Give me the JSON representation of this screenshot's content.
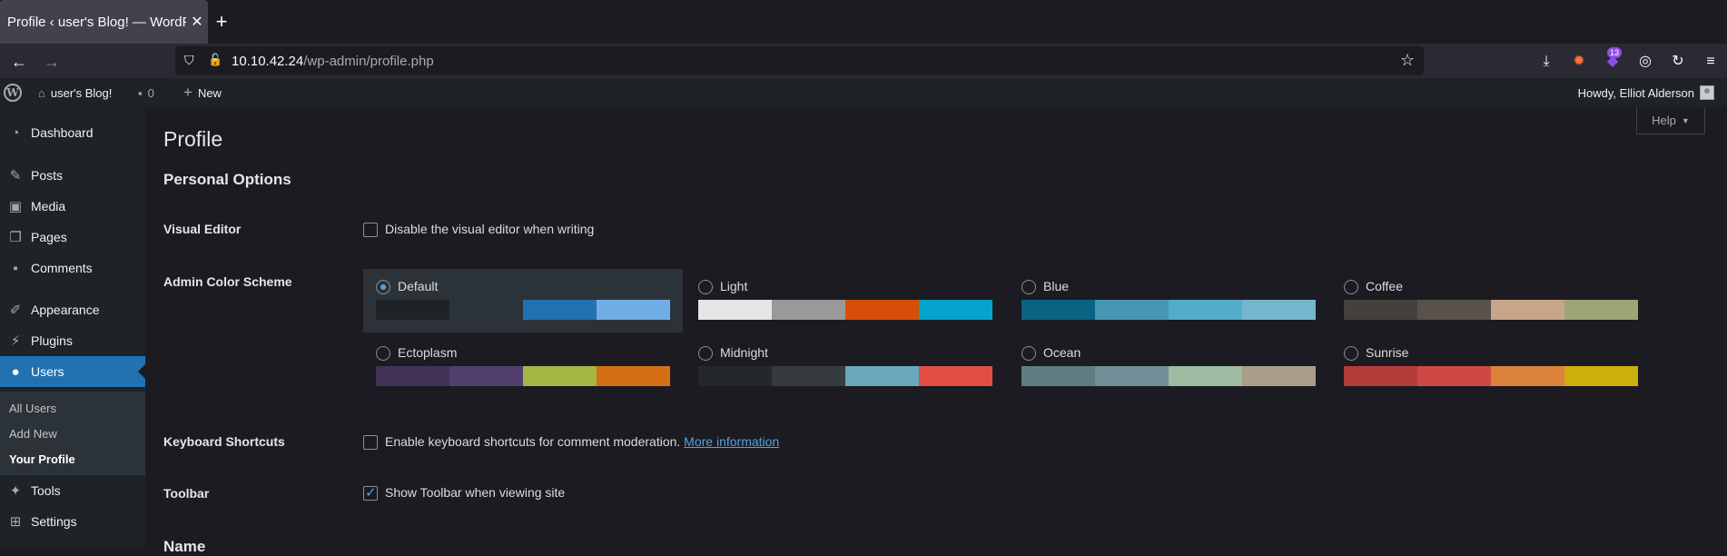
{
  "browser": {
    "tab_title": "Profile ‹ user's Blog! — WordPress",
    "tab_close": "✕",
    "new_tab": "+",
    "url_host": "10.10.42.24",
    "url_path": "/wp-admin/profile.php",
    "extension_badge": "13"
  },
  "adminbar": {
    "logo": "W",
    "site_name": "user's Blog!",
    "comments_count": "0",
    "new_label": "New",
    "howdy": "Howdy, Elliot Alderson"
  },
  "sidebar": {
    "items": [
      {
        "label": "Dashboard",
        "icon": "dashboard-icon"
      },
      {
        "label": "Posts",
        "icon": "pin-icon"
      },
      {
        "label": "Media",
        "icon": "media-icon"
      },
      {
        "label": "Pages",
        "icon": "pages-icon"
      },
      {
        "label": "Comments",
        "icon": "comment-icon"
      },
      {
        "label": "Appearance",
        "icon": "brush-icon"
      },
      {
        "label": "Plugins",
        "icon": "plugin-icon"
      },
      {
        "label": "Users",
        "icon": "user-icon"
      },
      {
        "label": "Tools",
        "icon": "wrench-icon"
      },
      {
        "label": "Settings",
        "icon": "settings-icon"
      }
    ],
    "submenu": [
      "All Users",
      "Add New",
      "Your Profile"
    ]
  },
  "main": {
    "help_label": "Help",
    "page_title": "Profile",
    "section_title": "Personal Options",
    "visual_editor_label": "Visual Editor",
    "visual_editor_text": "Disable the visual editor when writing",
    "color_scheme_label": "Admin Color Scheme",
    "schemes": [
      {
        "name": "Default",
        "colors": [
          "#1d2327",
          "#2c3338",
          "#2271b1",
          "#72aee6"
        ],
        "selected": true
      },
      {
        "name": "Light",
        "colors": [
          "#e5e5e5",
          "#999999",
          "#d64e07",
          "#04a4cc"
        ]
      },
      {
        "name": "Blue",
        "colors": [
          "#096484",
          "#4796b3",
          "#52accc",
          "#74b6ce"
        ]
      },
      {
        "name": "Coffee",
        "colors": [
          "#46403c",
          "#59524c",
          "#c7a589",
          "#9ea476"
        ]
      },
      {
        "name": "Ectoplasm",
        "colors": [
          "#413256",
          "#523f6d",
          "#a3b745",
          "#d46f15"
        ]
      },
      {
        "name": "Midnight",
        "colors": [
          "#25282b",
          "#363b3f",
          "#69a8bb",
          "#e14d43"
        ]
      },
      {
        "name": "Ocean",
        "colors": [
          "#627c83",
          "#738e96",
          "#9ebaa0",
          "#aa9d88"
        ]
      },
      {
        "name": "Sunrise",
        "colors": [
          "#b43c38",
          "#cf4944",
          "#dd823b",
          "#ccaf0b"
        ]
      }
    ],
    "keyboard_label": "Keyboard Shortcuts",
    "keyboard_text": "Enable keyboard shortcuts for comment moderation.",
    "keyboard_link": "More information",
    "toolbar_label": "Toolbar",
    "toolbar_text": "Show Toolbar when viewing site",
    "name_heading": "Name"
  }
}
